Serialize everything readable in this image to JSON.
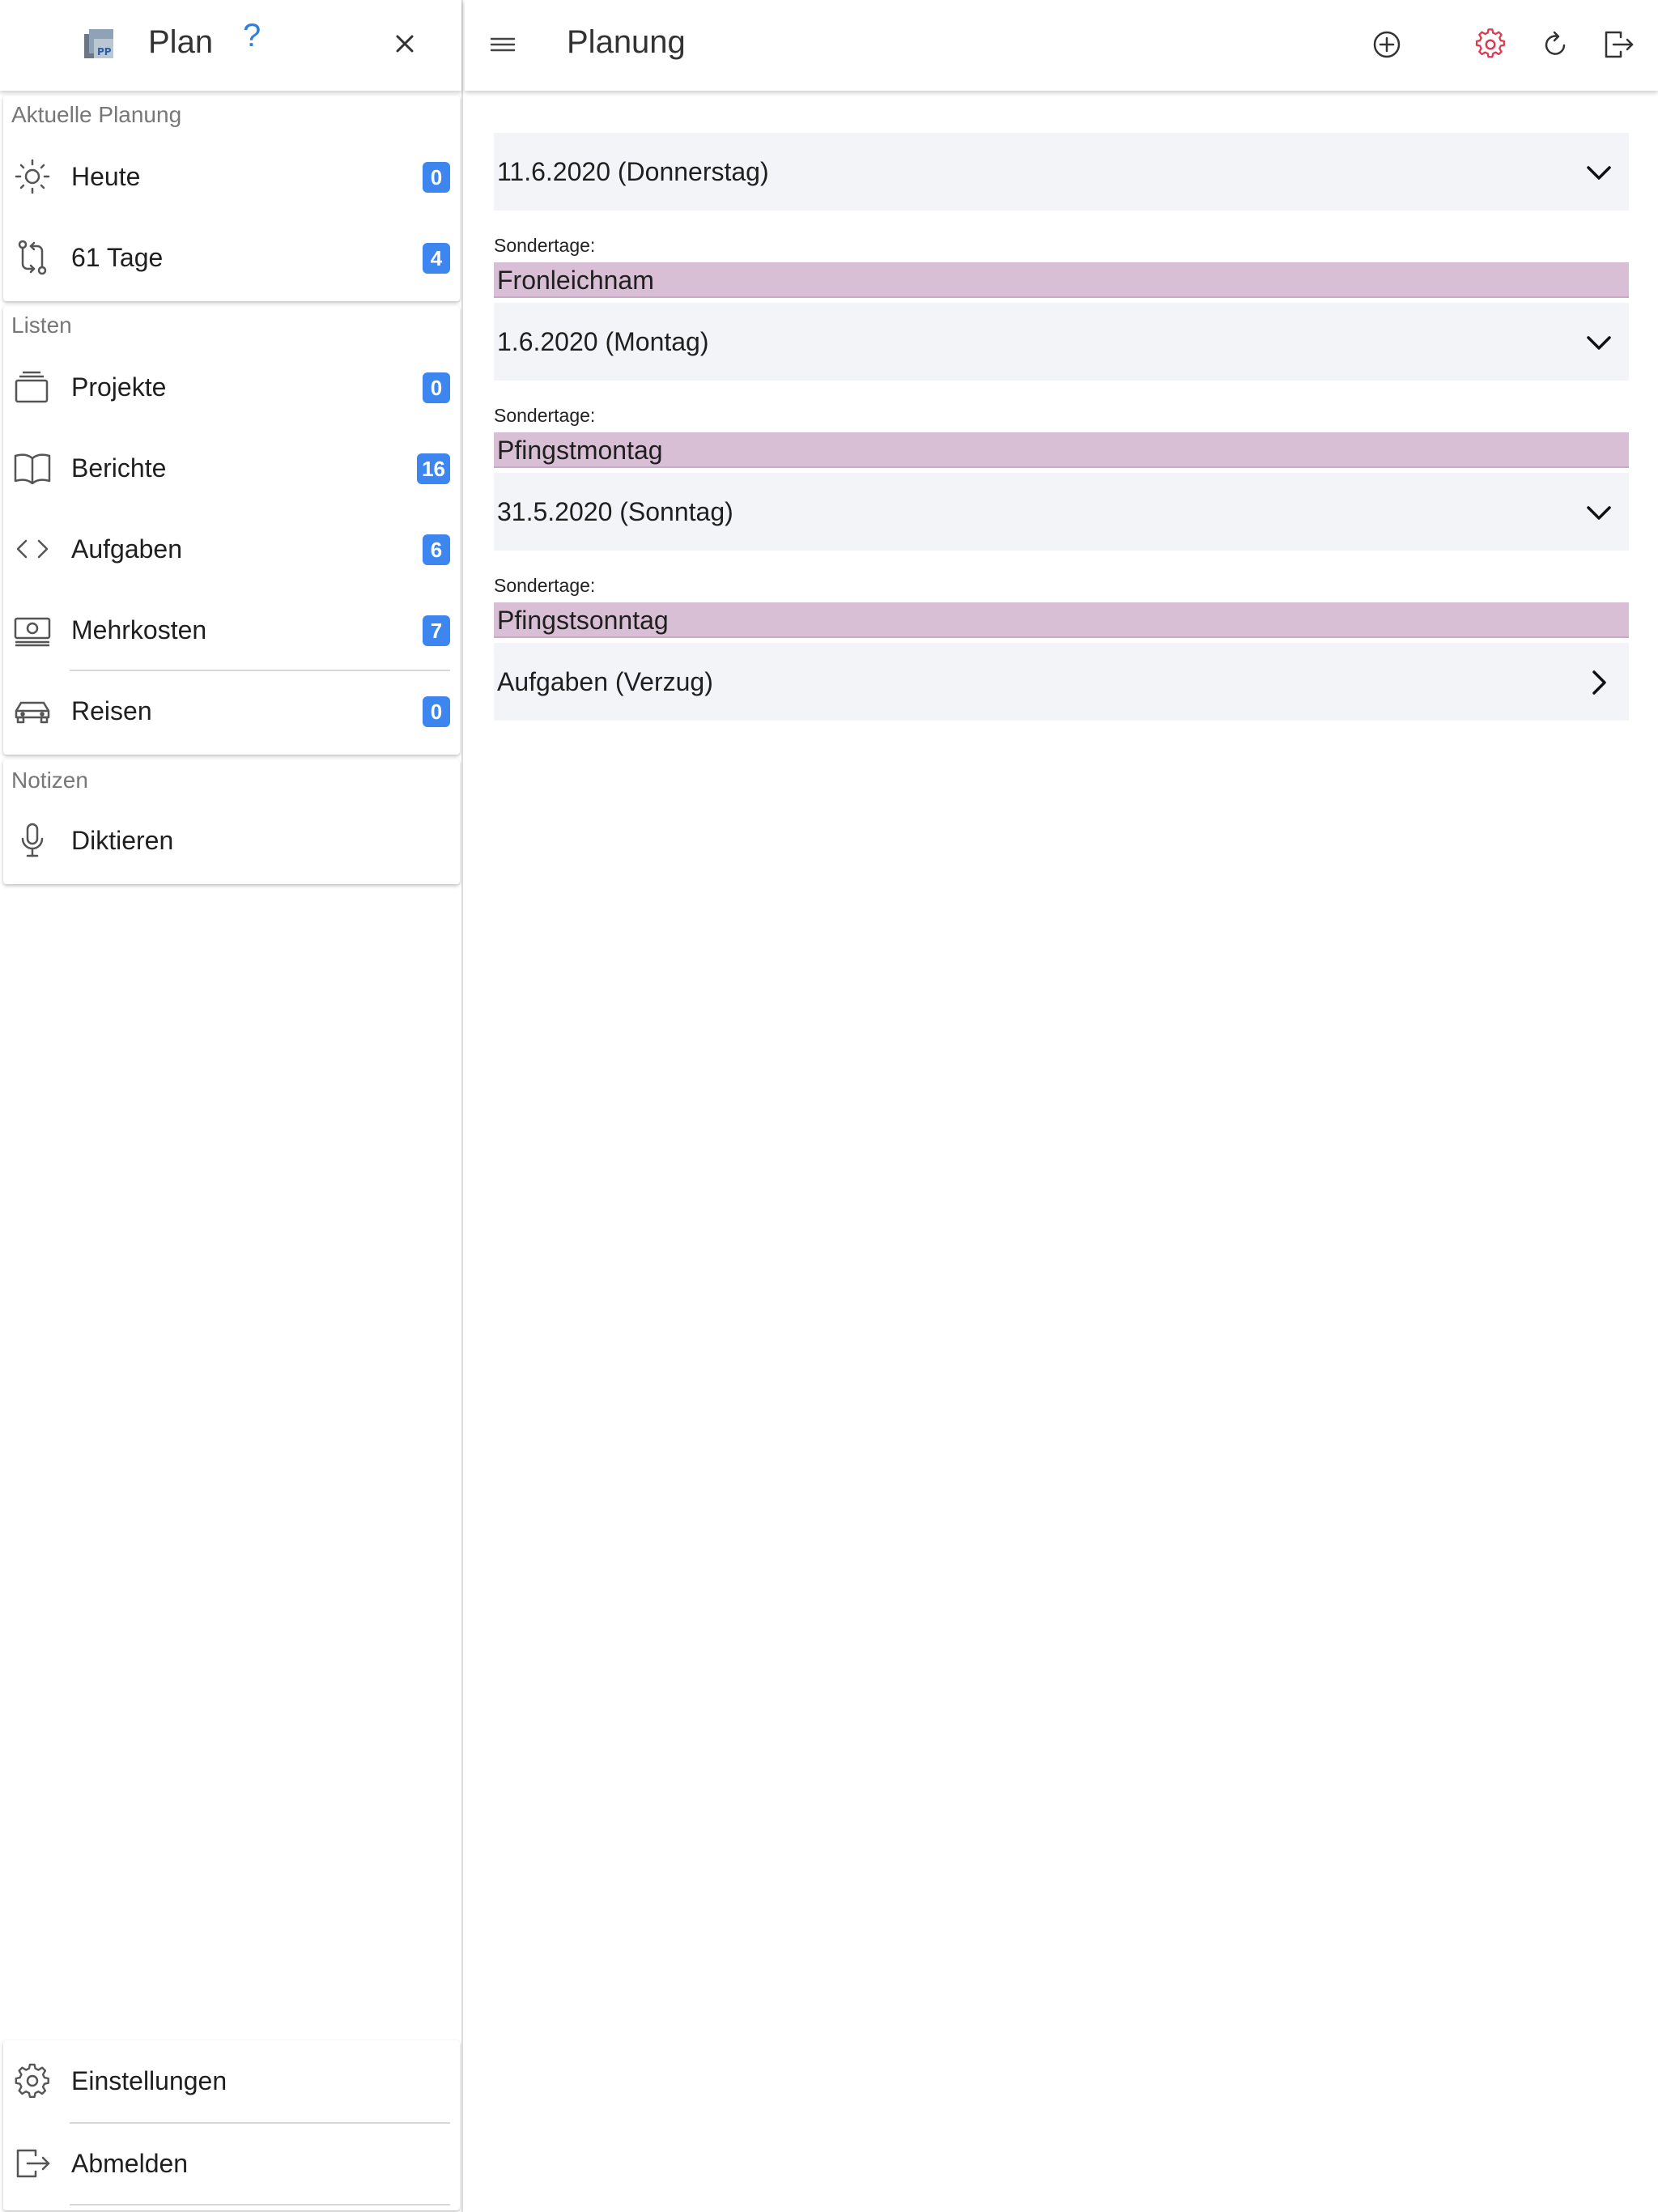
{
  "sidebar": {
    "title": "Plan",
    "help_glyph": "?",
    "sections": [
      {
        "label": "Aktuelle Planung",
        "items": [
          {
            "label": "Heute",
            "icon": "sun-icon",
            "badge": "0"
          },
          {
            "label": "61 Tage",
            "icon": "git-compare-icon",
            "badge": "4"
          }
        ]
      },
      {
        "label": "Listen",
        "items": [
          {
            "label": "Projekte",
            "icon": "layers-icon",
            "badge": "0"
          },
          {
            "label": "Berichte",
            "icon": "book-icon",
            "badge": "16"
          },
          {
            "label": "Aufgaben",
            "icon": "code-icon",
            "badge": "6"
          },
          {
            "label": "Mehrkosten",
            "icon": "cash-icon",
            "badge": "7"
          },
          {
            "label": "Reisen",
            "icon": "car-icon",
            "badge": "0"
          }
        ]
      },
      {
        "label": "Notizen",
        "items": [
          {
            "label": "Diktieren",
            "icon": "mic-icon"
          }
        ]
      }
    ],
    "footer": [
      {
        "label": "Einstellungen",
        "icon": "gear-icon"
      },
      {
        "label": "Abmelden",
        "icon": "logout-icon"
      }
    ]
  },
  "header": {
    "title": "Planung"
  },
  "main": {
    "special_days_label": "Sondertage:",
    "days": [
      {
        "label": "11.6.2020 (Donnerstag)",
        "special": "Fronleichnam"
      },
      {
        "label": "1.6.2020 (Montag)",
        "special": "Pfingstmontag"
      },
      {
        "label": "31.5.2020 (Sonntag)",
        "special": "Pfingstsonntag"
      }
    ],
    "overdue": {
      "label": "Aufgaben (Verzug)"
    }
  },
  "colors": {
    "accent": "#3d86f0",
    "settings_icon": "#e0374f",
    "special_bar": "#d9bfd6",
    "row_bg": "#f3f4f7"
  }
}
